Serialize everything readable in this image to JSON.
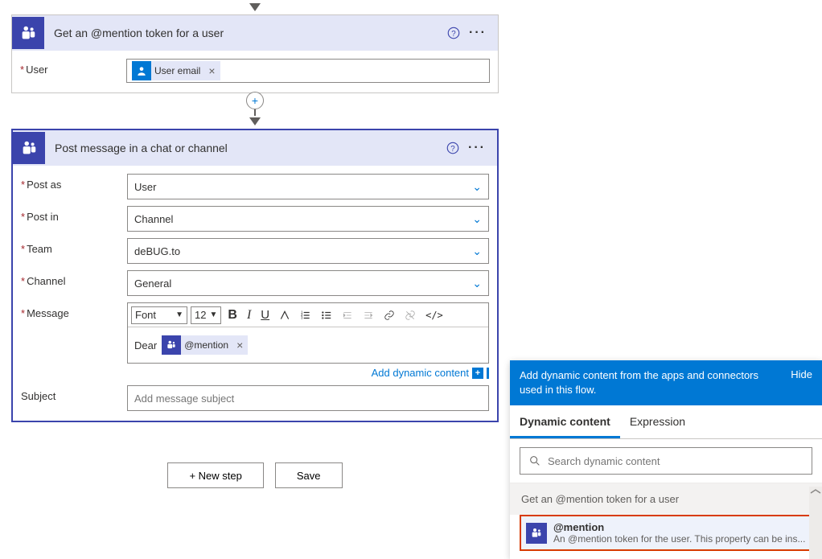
{
  "card1": {
    "title": "Get an @mention token for a user",
    "field_user_label": "User",
    "token_label": "User email"
  },
  "card2": {
    "title": "Post message in a chat or channel",
    "labels": {
      "post_as": "Post as",
      "post_in": "Post in",
      "team": "Team",
      "channel": "Channel",
      "message": "Message",
      "subject": "Subject"
    },
    "values": {
      "post_as": "User",
      "post_in": "Channel",
      "team": "deBUG.to",
      "channel": "General"
    },
    "rte": {
      "font": "Font",
      "size": "12",
      "body_prefix": "Dear",
      "token": "@mention"
    },
    "subject_placeholder": "Add message subject",
    "add_dyn": "Add dynamic content"
  },
  "footer": {
    "new_step": "+ New step",
    "save": "Save"
  },
  "dyn": {
    "header": "Add dynamic content from the apps and connectors used in this flow.",
    "hide": "Hide",
    "tab_dynamic": "Dynamic content",
    "tab_expression": "Expression",
    "search_placeholder": "Search dynamic content",
    "section": "Get an @mention token for a user",
    "item_title": "@mention",
    "item_desc": "An @mention token for the user. This property can be ins..."
  }
}
